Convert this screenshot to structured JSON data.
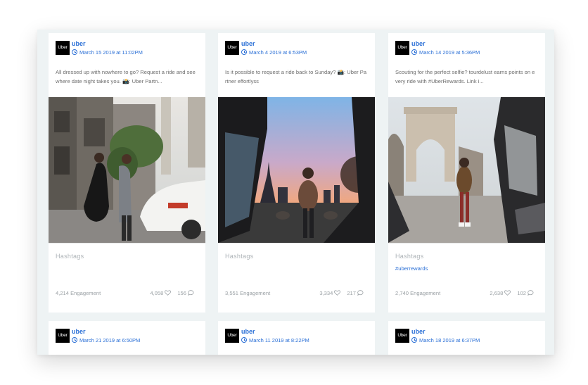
{
  "posts": [
    {
      "logo_text": "Uber",
      "account": "uber",
      "date": "March 15 2019 at 11:02PM",
      "caption": "All dressed up with nowhere to go? Request a ride and see where date night takes you. 📸: Uber Partn...",
      "hashtags_title": "Hashtags",
      "hashtags": "",
      "engagement": "4,214 Engagement",
      "likes": "4,058",
      "comments": "156"
    },
    {
      "logo_text": "Uber",
      "account": "uber",
      "date": "March 4 2019 at 6:53PM",
      "caption": "Is it possible to request a ride back to Sunday? 📸: Uber Pa rtner effortlyss",
      "hashtags_title": "Hashtags",
      "hashtags": "",
      "engagement": "3,551 Engagement",
      "likes": "3,334",
      "comments": "217"
    },
    {
      "logo_text": "Uber",
      "account": "uber",
      "date": "March 14 2019 at 5:36PM",
      "caption": "Scouting for the perfect selfie? tourdelust earns points on e very ride with #UberRewards. Link i...",
      "hashtags_title": "Hashtags",
      "hashtags": "#uberrewards",
      "engagement": "2,740 Engagement",
      "likes": "2,638",
      "comments": "102"
    }
  ],
  "next_posts": [
    {
      "logo_text": "Uber",
      "account": "uber",
      "date": "March 21 2019 at 6:50PM"
    },
    {
      "logo_text": "Uber",
      "account": "uber",
      "date": "March 11 2019 at 8:22PM"
    },
    {
      "logo_text": "Uber",
      "account": "uber",
      "date": "March 18 2019 at 6:37PM"
    }
  ],
  "colors": {
    "accent": "#2a6fd6",
    "board_background": "#eef3f4",
    "muted_text": "#9aa0a4"
  },
  "icons": [
    "clock-icon",
    "heart-icon",
    "comment-icon"
  ]
}
